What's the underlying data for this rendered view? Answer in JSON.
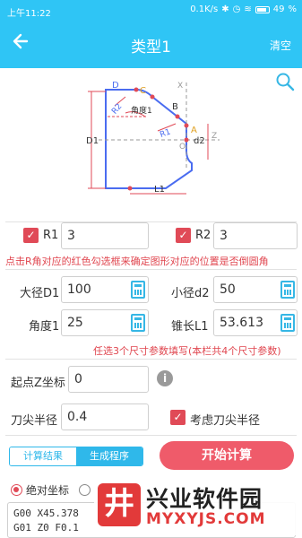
{
  "status_bar": {
    "time": "上午11:22",
    "network": "0.1K/s",
    "battery": "49"
  },
  "app_bar": {
    "title": "类型1",
    "back_icon": "back-arrow-icon",
    "clear_label": "清空"
  },
  "diagram": {
    "labels": {
      "D": "D",
      "C": "C",
      "B": "B",
      "A": "A",
      "X": "X",
      "Z": "Z",
      "O": "O",
      "R1": "R1",
      "R2": "R2",
      "angle": "角度1",
      "D1": "D1",
      "d2": "d2",
      "L1": "L1"
    }
  },
  "fillet": {
    "r1_label": "R1",
    "r1_value": "3",
    "r1_checked": true,
    "r2_label": "R2",
    "r2_value": "3",
    "r2_checked": true,
    "hint": "点击R角对应的红色勾选框来确定图形对应的位置是否倒圆角"
  },
  "params": {
    "big_d_label": "大径D1",
    "big_d_value": "100",
    "small_d_label": "小径d2",
    "small_d_value": "50",
    "angle_label": "角度1",
    "angle_value": "25",
    "taper_len_label": "锥长L1",
    "taper_len_value": "53.613",
    "hint": "任选3个尺寸参数填写(本栏共4个尺寸参数)"
  },
  "start_z": {
    "label": "起点Z坐标",
    "value": "0"
  },
  "nose": {
    "label": "刀尖半径",
    "value": "0.4",
    "consider_label": "考虑刀尖半径",
    "consider_checked": true
  },
  "actions": {
    "tab_result": "计算结果",
    "tab_program": "生成程序",
    "start_button": "开始计算"
  },
  "coord_mode": {
    "absolute_label": "绝对坐标"
  },
  "program_lines": {
    "line1": "G00 X45.378",
    "line2": "G01 Z0 F0.1"
  },
  "watermark": {
    "logo_glyph": "井",
    "title": "兴业软件园",
    "url": "MYXYJS.COM"
  },
  "colors": {
    "accent": "#2fc5f5",
    "danger": "#e04a57",
    "button": "#ef5b6a"
  }
}
